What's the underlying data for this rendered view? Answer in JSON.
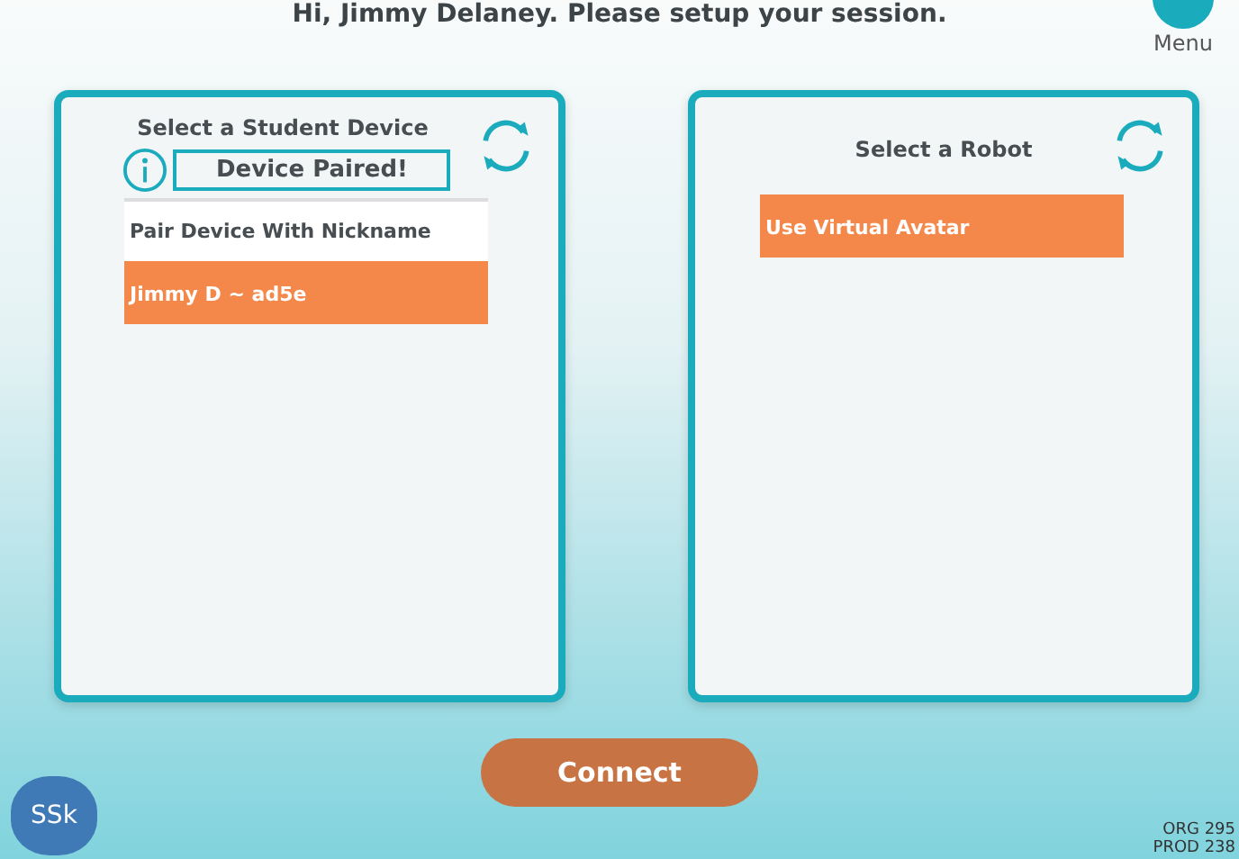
{
  "header": {
    "greeting": "Hi, Jimmy Delaney. Please setup your session.",
    "menu_label": "Menu"
  },
  "panels": [
    {
      "title": "Select a Student Device",
      "status": "Device Paired!",
      "items": [
        {
          "label": "Pair Device With Nickname",
          "selected": false
        },
        {
          "label": "Jimmy D ~ ad5e",
          "selected": true
        }
      ]
    },
    {
      "title": "Select a Robot",
      "items": [
        {
          "label": "Use Virtual Avatar",
          "selected": true
        }
      ]
    }
  ],
  "connect_button": "Connect",
  "logo": "SSk",
  "footer": [
    "ORG 295",
    "PROD 238"
  ]
}
